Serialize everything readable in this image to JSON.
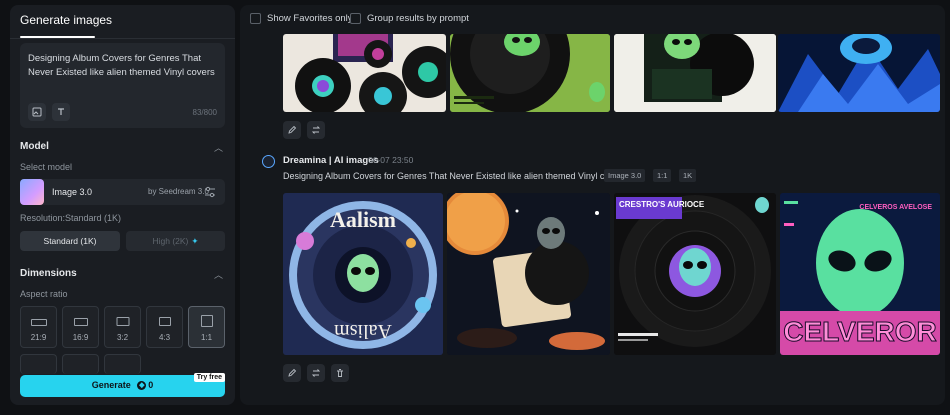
{
  "sidebar": {
    "tab_label": "Generate images",
    "prompt_text": "Designing Album Covers for Genres That Never Existed like alien themed Vinyl covers",
    "char_count": "83/800",
    "model_section": "Model",
    "select_model_label": "Select model",
    "model_name": "Image 3.0",
    "model_by": "by Seedream 3.0",
    "resolution_label": "Resolution:Standard (1K)",
    "res_standard": "Standard (1K)",
    "res_high": "High (2K)",
    "dimensions_section": "Dimensions",
    "aspect_ratio_label": "Aspect ratio",
    "ratios": [
      "21:9",
      "16:9",
      "3:2",
      "4:3",
      "1:1"
    ],
    "selected_ratio": "1:1",
    "generate_label": "Generate",
    "generate_cost": "0",
    "try_free": "Try free"
  },
  "filters": {
    "favorites": "Show Favorites only",
    "group": "Group results by prompt"
  },
  "generation": {
    "author": "Dreamina | AI images",
    "date": "06-07   23:50",
    "prompt": "Designing Album Covers for Genres That Never Existed like alien themed Vinyl covers",
    "tags": [
      "Image 3.0",
      "1:1",
      "1K"
    ]
  },
  "covers": {
    "c1_title": "Aalism",
    "c3_title": "CRESTRO'S AURIOCE",
    "c4_top": "CELVEROS AVELOSE",
    "c4_big": "CELVEROR"
  },
  "icons": {
    "accent": "#27d3ee",
    "alien_green": "#59e0a0"
  }
}
